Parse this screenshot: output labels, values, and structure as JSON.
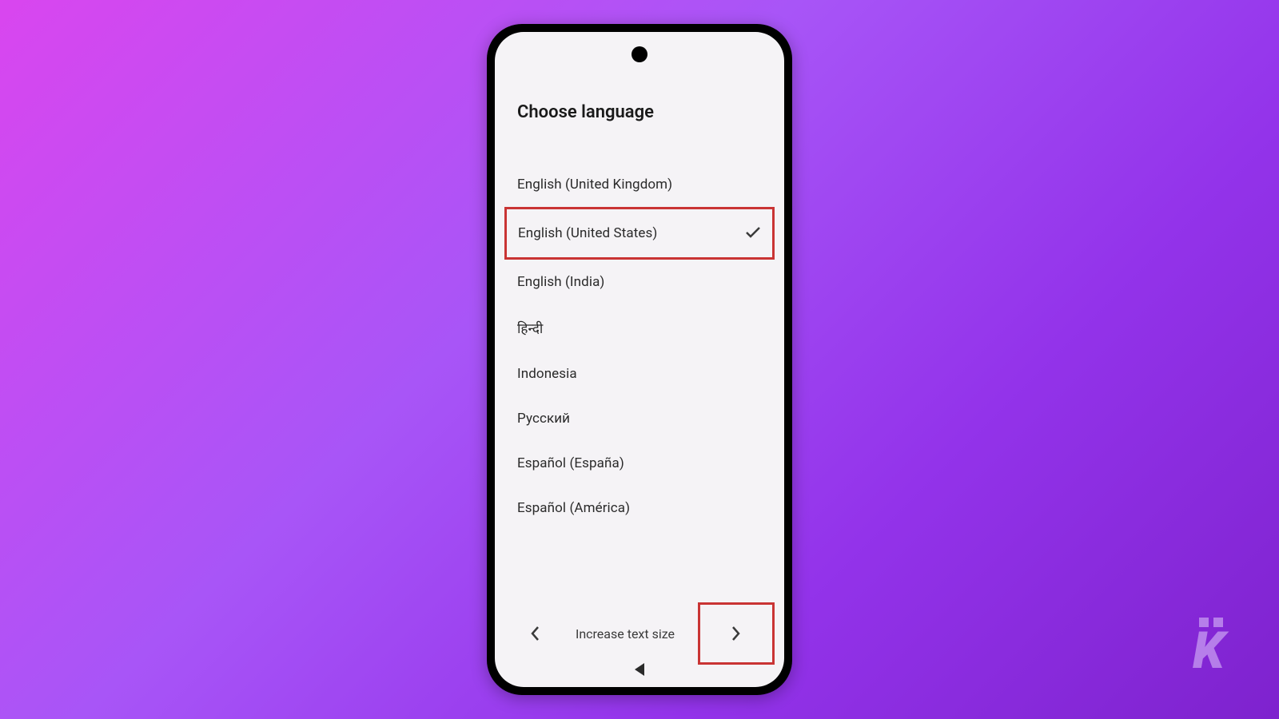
{
  "page_title": "Choose language",
  "languages": [
    {
      "label": "English (United Kingdom)",
      "selected": false
    },
    {
      "label": "English (United States)",
      "selected": true
    },
    {
      "label": "English (India)",
      "selected": false
    },
    {
      "label": "हिन्दी",
      "selected": false
    },
    {
      "label": "Indonesia",
      "selected": false
    },
    {
      "label": "Русский",
      "selected": false
    },
    {
      "label": "Español (España)",
      "selected": false
    },
    {
      "label": "Español (América)",
      "selected": false
    }
  ],
  "bottom": {
    "text_size_label": "Increase text size"
  },
  "highlight_color": "#c93434",
  "watermark": "K"
}
